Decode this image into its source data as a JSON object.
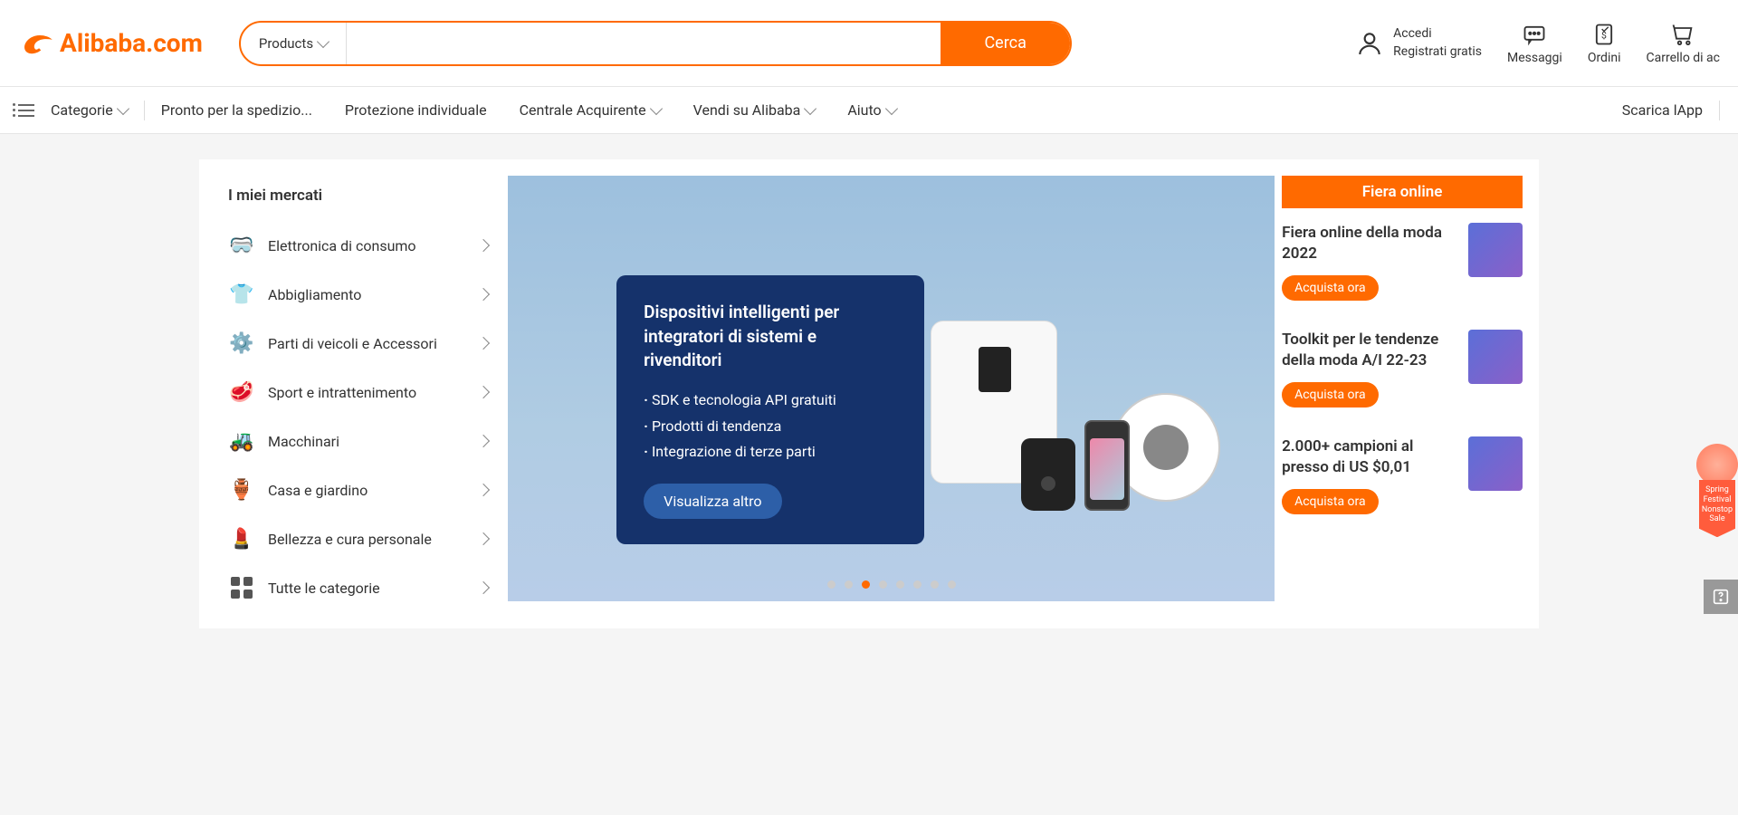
{
  "brand": "Alibaba.com",
  "search": {
    "dropdown": "Products",
    "button": "Cerca",
    "placeholder": ""
  },
  "account": {
    "login": "Accedi",
    "register": "Registrati gratis"
  },
  "topIcons": {
    "messages": "Messaggi",
    "orders": "Ordini",
    "cart": "Carrello di ac"
  },
  "nav": {
    "categories": "Categorie",
    "items": [
      "Pronto per la spedizio...",
      "Protezione individuale",
      "Centrale Acquirente",
      "Vendi su Alibaba",
      "Aiuto"
    ],
    "hasDropdown": [
      false,
      false,
      true,
      true,
      true
    ],
    "download": "Scarica lApp"
  },
  "sidebar": {
    "title": "I miei mercati",
    "items": [
      {
        "label": "Elettronica di consumo",
        "icon": "🥽"
      },
      {
        "label": "Abbigliamento",
        "icon": "👕"
      },
      {
        "label": "Parti di veicoli e Accessori",
        "icon": "⚙️"
      },
      {
        "label": "Sport e intrattenimento",
        "icon": "🥩"
      },
      {
        "label": "Macchinari",
        "icon": "🚜"
      },
      {
        "label": "Casa e giardino",
        "icon": "🏺"
      },
      {
        "label": "Bellezza e cura personale",
        "icon": "💄"
      }
    ],
    "all": "Tutte le categorie"
  },
  "hero": {
    "title": "Dispositivi intelligenti per integratori di sistemi e rivenditori",
    "bullets": [
      "SDK e tecnologia API gratuiti",
      "Prodotti di tendenza",
      "Integrazione di terze parti"
    ],
    "button": "Visualizza altro",
    "dotCount": 8,
    "activeDot": 2
  },
  "promo": {
    "header": "Fiera online",
    "items": [
      {
        "title": "Fiera online della moda 2022",
        "button": "Acquista ora"
      },
      {
        "title": "Toolkit per le tendenze della moda A/I 22-23",
        "button": "Acquista ora"
      },
      {
        "title": "2.000+ campioni al presso di US $0,01",
        "button": "Acquista ora"
      }
    ]
  },
  "floatBadge": "Spring Festival Nonstop Sale"
}
